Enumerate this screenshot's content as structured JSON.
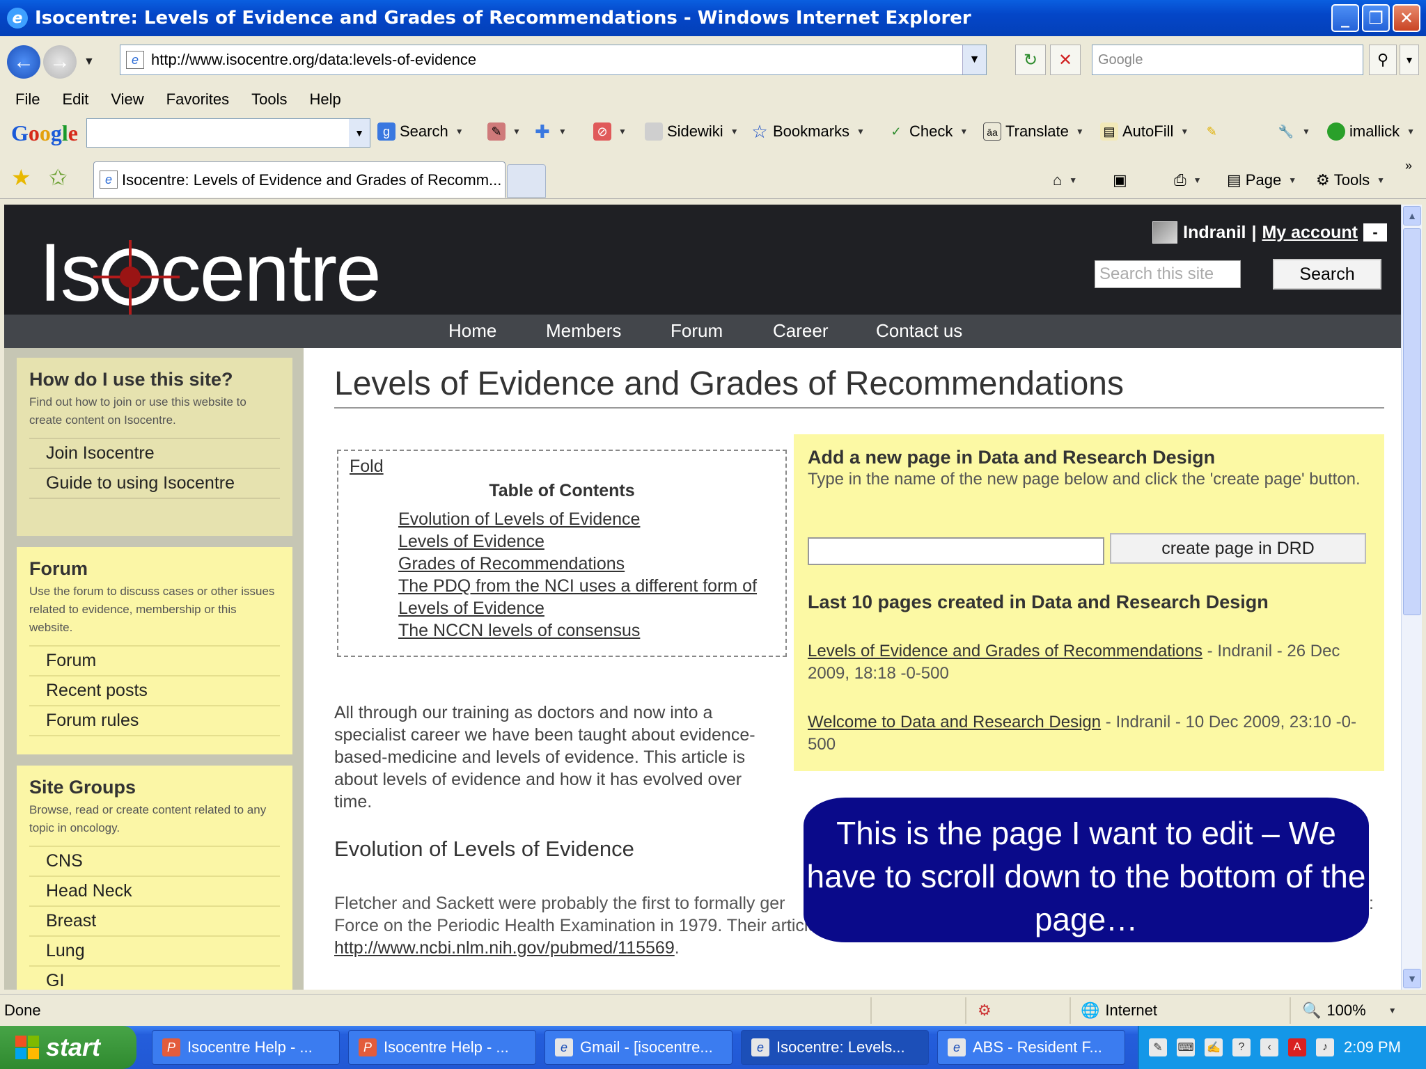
{
  "window": {
    "title": "Isocentre: Levels of Evidence and Grades of Recommendations - Windows Internet Explorer"
  },
  "address_bar": {
    "url": "http://www.isocentre.org/data:levels-of-evidence",
    "search_placeholder": "Google"
  },
  "menu": [
    "File",
    "Edit",
    "View",
    "Favorites",
    "Tools",
    "Help"
  ],
  "google_toolbar": {
    "logo": "Google",
    "items": [
      "Search",
      "Sidewiki",
      "Bookmarks",
      "Check",
      "Translate",
      "AutoFill",
      "imallick"
    ]
  },
  "tab": {
    "title": "Isocentre: Levels of Evidence and Grades of Recomm...",
    "commands": [
      "Page",
      "Tools"
    ]
  },
  "site": {
    "logo": {
      "left": "Is",
      "right": "centre"
    },
    "user": {
      "name": "Indranil",
      "separator": "|",
      "account_link": "My account",
      "minus": "-"
    },
    "search": {
      "placeholder": "Search this site",
      "button": "Search"
    },
    "nav": [
      "Home",
      "Members",
      "Forum",
      "Career",
      "Contact us"
    ]
  },
  "sidebar": {
    "help": {
      "title": "How do I use this site?",
      "desc": "Find out how to join or use this website to create content on Isocentre.",
      "links": [
        "Join Isocentre",
        "Guide to using Isocentre"
      ]
    },
    "forum": {
      "title": "Forum",
      "desc": "Use the forum to discuss cases or other issues related to evidence, membership or this website.",
      "links": [
        "Forum",
        "Recent posts",
        "Forum rules"
      ]
    },
    "groups": {
      "title": "Site Groups",
      "desc": "Browse, read or create content related to any topic in oncology.",
      "links": [
        "CNS",
        "Head Neck",
        "Breast",
        "Lung",
        "GI"
      ]
    }
  },
  "content": {
    "title": "Levels of Evidence and Grades of Recommendations",
    "toc": {
      "fold": "Fold",
      "title": "Table of Contents",
      "items": [
        "Evolution of Levels of Evidence",
        "Levels of Evidence",
        "Grades of Recommendations",
        "The PDQ from the NCI uses a different form of",
        "Levels of Evidence",
        "The NCCN levels of consensus"
      ]
    },
    "intro": "All through our training as doctors and now into a specialist career we have been taught about evidence-based-medicine and levels of evidence. This article is about levels of evidence and how it has evolved over time.",
    "section_heading": "Evolution of Levels of Evidence",
    "section_text_line1": "Fletcher and Sackett were probably the first to formally ger",
    "section_text_line1_end": ":",
    "section_text_line2": "Force on the Periodic Health Examination in 1979. Their article",
    "section_link": "http://www.ncbi.nlm.nih.gov/pubmed/115569",
    "section_link_end": "."
  },
  "new_page_box": {
    "title": "Add a new page in Data and Research Design",
    "desc": "Type in the name of the new page below and click the 'create page' button.",
    "button": "create page in DRD",
    "recent_title": "Last 10 pages created in Data and Research Design",
    "recent": [
      {
        "link": "Levels of Evidence and Grades of Recommendations",
        "meta": " - Indranil - 26 Dec 2009, 18:18 -0-500"
      },
      {
        "link": "Welcome to Data and Research Design",
        "meta": " - Indranil - 10 Dec 2009, 23:10 -0-500"
      }
    ]
  },
  "callout": "This is the page I want to edit – We have to scroll down to the bottom of the page…",
  "status": {
    "text": "Done",
    "zone": "Internet",
    "zoom": "100%"
  },
  "taskbar": {
    "start": "start",
    "tasks": [
      "Isocentre Help - ...",
      "Isocentre Help - ...",
      "Gmail - [isocentre...",
      "Isocentre: Levels...",
      "ABS - Resident F..."
    ],
    "time": "2:09 PM"
  }
}
